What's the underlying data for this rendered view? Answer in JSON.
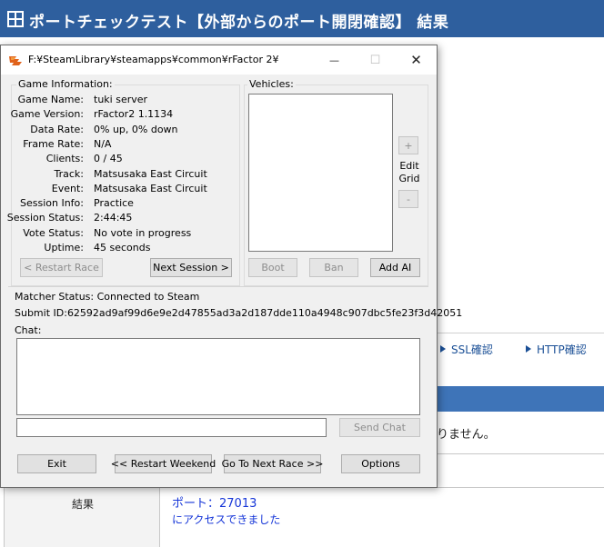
{
  "web": {
    "title": "ポートチェックテスト【外部からのポート開閉確認】 結果",
    "nav": [
      "SSL確認",
      "HTTP確認"
    ],
    "message": "りません。",
    "result_label": "結果",
    "result_port": "ポート：27013",
    "result_access": "にアクセスできました"
  },
  "window": {
    "title": "F:¥SteamLibrary¥steamapps¥common¥rFactor 2¥",
    "minimize_icon": "—",
    "maximize_icon": "☐",
    "close_icon": "✕"
  },
  "game_info": {
    "group_label": "Game Information:",
    "fields": [
      {
        "label": "Game Name:",
        "value": "tuki server"
      },
      {
        "label": "Game Version:",
        "value": "rFactor2 1.1134"
      },
      {
        "label": "Data Rate:",
        "value": "0% up, 0% down"
      },
      {
        "label": "Frame Rate:",
        "value": "N/A"
      },
      {
        "label": "Clients:",
        "value": "0 / 45"
      },
      {
        "label": "Track:",
        "value": "Matsusaka East Circuit"
      },
      {
        "label": "Event:",
        "value": "Matsusaka East Circuit"
      },
      {
        "label": "Session Info:",
        "value": "Practice"
      },
      {
        "label": "Session Status:",
        "value": "2:44:45"
      },
      {
        "label": "Vote Status:",
        "value": "No vote in progress"
      },
      {
        "label": "Uptime:",
        "value": "45 seconds"
      }
    ],
    "restart_race": "< Restart Race",
    "next_session": "Next Session >"
  },
  "vehicles": {
    "group_label": "Vehicles:",
    "plus": "+",
    "edit_grid": "Edit Grid",
    "minus": "-",
    "boot": "Boot",
    "ban": "Ban",
    "add_ai": "Add AI"
  },
  "status": {
    "matcher": "Matcher Status: Connected to Steam",
    "submit_id": "Submit ID:62592ad9af99d6e9e2d47855ad3a2d187dde110a4948c907dbc5fe23f3d42051",
    "chat_label": "Chat:",
    "chat_input": "",
    "send_chat": "Send Chat"
  },
  "bottom": {
    "exit": "Exit",
    "restart_weekend": "<< Restart Weekend",
    "next_race": "Go To Next Race >>",
    "options": "Options"
  }
}
